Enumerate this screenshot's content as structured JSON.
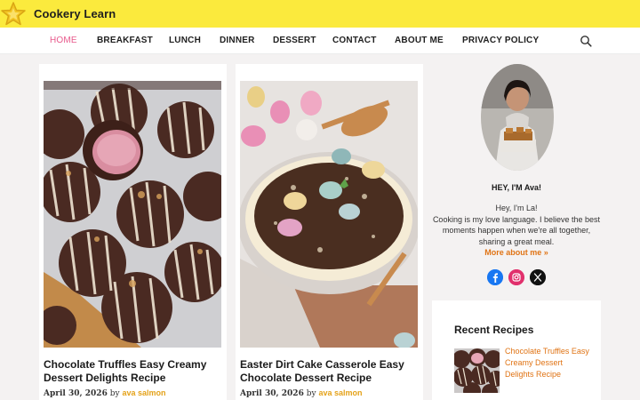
{
  "site": {
    "title": "Cookery Learn"
  },
  "nav": {
    "items": [
      "HOME",
      "BREAKFAST",
      "LUNCH",
      "DINNER",
      "DESSERT",
      "CONTACT",
      "ABOUT ME",
      "PRIVACY POLICY"
    ],
    "active": "HOME"
  },
  "posts": [
    {
      "title": "Chocolate Truffles Easy Creamy Dessert Delights Recipe",
      "date": "April 30, 2026",
      "by": "by",
      "author": "ava salmon"
    },
    {
      "title": "Easter Dirt Cake Casserole Easy Chocolate Dessert Recipe",
      "date": "April 30, 2026",
      "by": "by",
      "author": "ava salmon"
    }
  ],
  "sidebar": {
    "greeting": "HEY, I'M Ava!",
    "bio": "Hey, I'm La!\nCooking is my love language. I believe the best moments happen when we're all together, sharing a great meal.",
    "more_link": "More about me »",
    "social": [
      "facebook-icon",
      "instagram-icon",
      "x-icon"
    ],
    "recent_heading": "Recent Recipes",
    "recent_items": [
      {
        "title": "Chocolate Truffles Easy Creamy Dessert Delights Recipe"
      }
    ]
  },
  "colors": {
    "topbar": "#fbea3d",
    "accent_pink": "#e85a8c",
    "link_orange": "#e07415",
    "author_gold": "#e4a21a"
  }
}
